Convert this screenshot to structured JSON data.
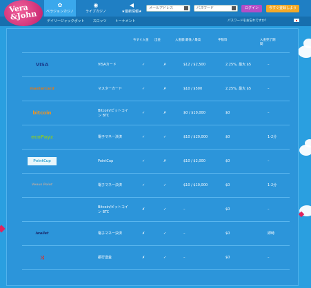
{
  "brand": {
    "line1": "Vera",
    "line2": "&John"
  },
  "nav": [
    {
      "label": "ベラジョンカジノ",
      "icon": "gear-icon",
      "glyph": "✿"
    },
    {
      "label": "ライブカジノ",
      "icon": "chip-icon",
      "glyph": "◉"
    },
    {
      "label": "★最新情報★",
      "icon": "megaphone-icon",
      "glyph": "◀"
    }
  ],
  "login": {
    "email_placeholder": "メールアドレス",
    "password_placeholder": "パスワード",
    "login_label": "ログイン",
    "register_label": "今すぐ登録しよう"
  },
  "subnav": [
    "デイリージャックポット",
    "スロッツ",
    "トーナメント"
  ],
  "forgot_password": "パスワードをお忘れですか？",
  "table": {
    "headers": [
      "今すぐ入金",
      "出金",
      "入金額 最低 / 最高",
      "手数料",
      "入金完了期間"
    ],
    "rows": [
      {
        "logo": "VISA",
        "logo_color": "#1a3f8f",
        "name": "VISAカード",
        "deposit": "✓",
        "withdraw": "✗",
        "limits": "$12 / $2,500",
        "fee": "2.25%, 最大 $5",
        "time": "–"
      },
      {
        "logo": "mastercard",
        "logo_color": "#e07a1c",
        "name": "マスターカード",
        "deposit": "✓",
        "withdraw": "✗",
        "limits": "$10 / $500",
        "fee": "2.25%, 最大 $5",
        "time": "–"
      },
      {
        "logo": "bitcoin",
        "logo_color": "#f7931a",
        "name": "Bitcoin/ビットコイン BTC",
        "deposit": "✓",
        "withdraw": "✗",
        "limits": "$0 / $10,000",
        "fee": "$0",
        "time": "–"
      },
      {
        "logo": "ecoPayz",
        "logo_color": "#7cc242",
        "name": "電子マネー決済",
        "deposit": "✓",
        "withdraw": "✓",
        "limits": "$10 / $20,000",
        "fee": "$0",
        "time": "1-2分"
      },
      {
        "logo": "PointCup",
        "logo_color": "#4bb0d8",
        "name": "PointCup",
        "deposit": "✓",
        "withdraw": "✗",
        "limits": "$10 / $2,000",
        "fee": "$0",
        "time": "–"
      },
      {
        "logo": "Venus Point",
        "logo_color": "#a9a9a9",
        "name": "電子マネー決済",
        "deposit": "✓",
        "withdraw": "✓",
        "limits": "$10 / $10,000",
        "fee": "$0",
        "time": "1-2分"
      },
      {
        "logo": "",
        "logo_color": "#2c95da",
        "name": "Bitcoin/ビットコイン BTC",
        "deposit": "✗",
        "withdraw": "✓",
        "limits": "–",
        "fee": "$0",
        "time": "–"
      },
      {
        "logo": "iwallet",
        "logo_color": "#1a2a6c",
        "name": "電子マネー決済",
        "deposit": "✗",
        "withdraw": "✓",
        "limits": "–",
        "fee": "$0",
        "time": "即時"
      },
      {
        "logo": "⤨",
        "logo_color": "#d8312c",
        "name": "銀行送金",
        "deposit": "✗",
        "withdraw": "✓",
        "limits": "–",
        "fee": "$0",
        "time": "–"
      }
    ]
  }
}
